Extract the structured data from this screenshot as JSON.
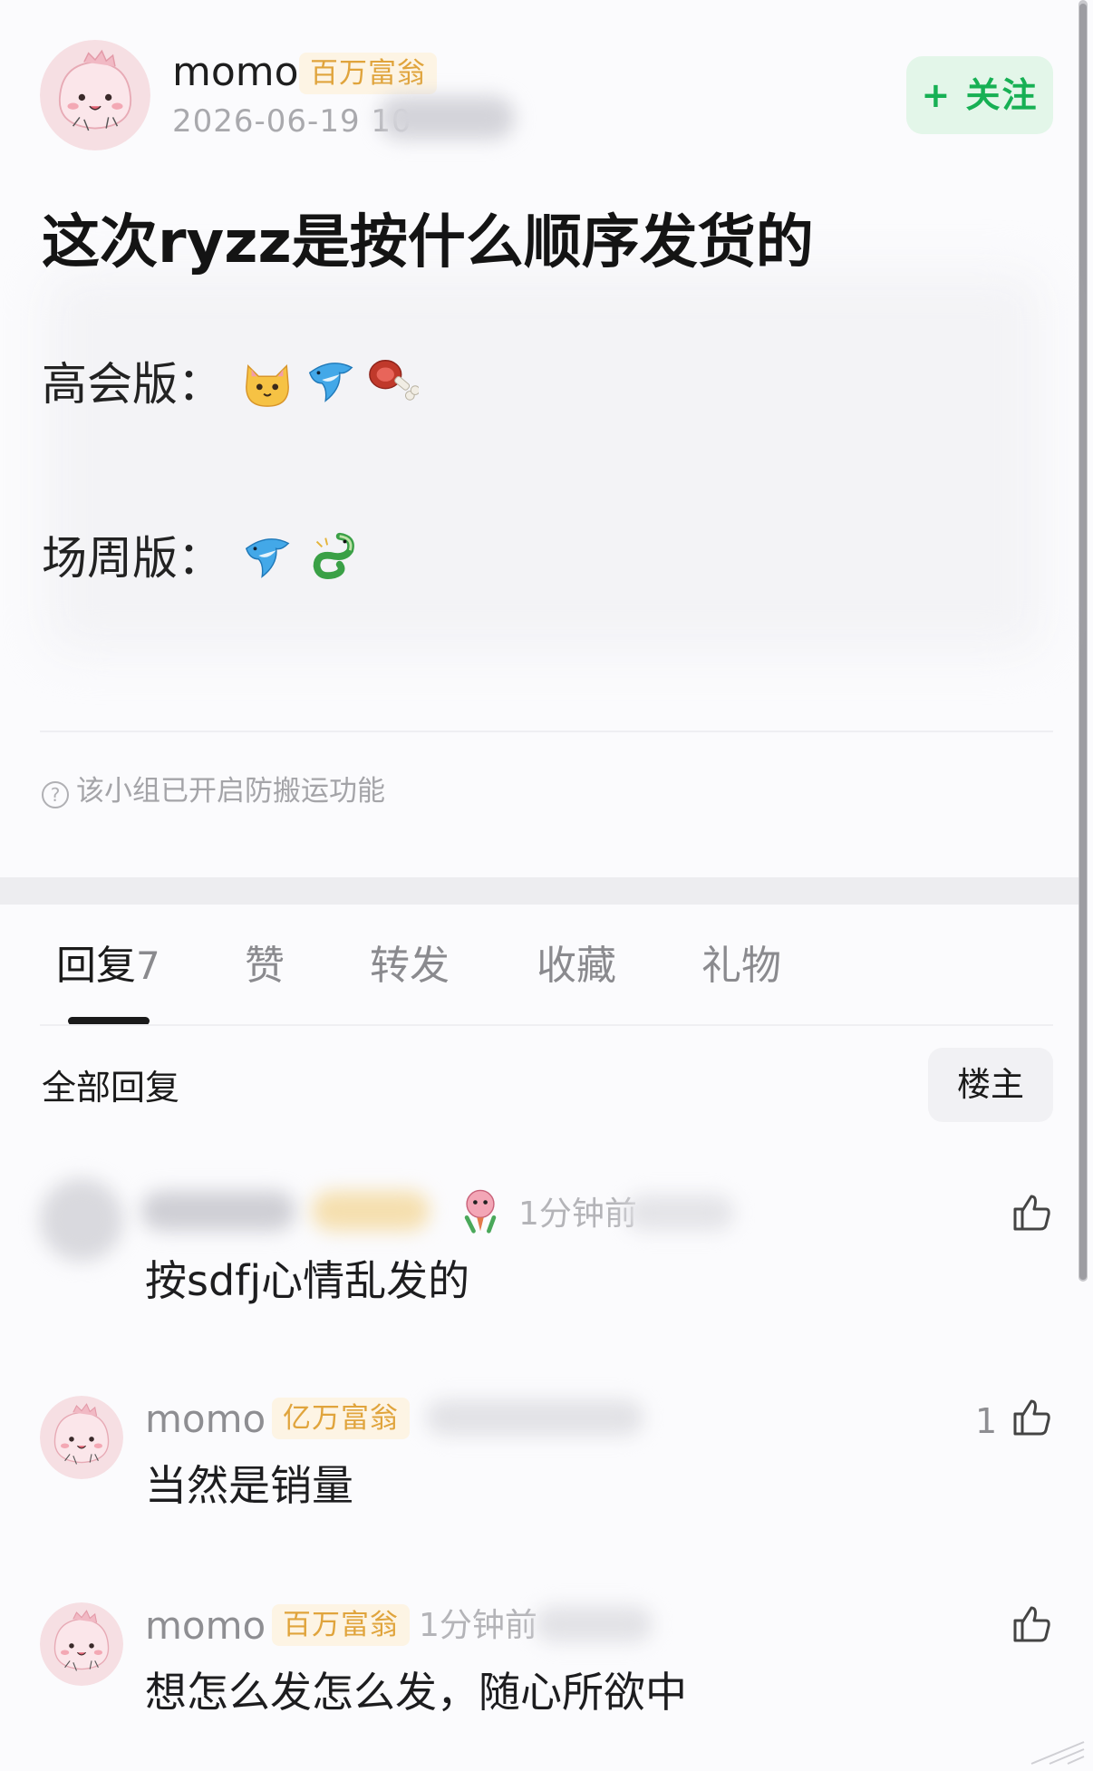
{
  "post": {
    "author": "momo",
    "badge": "百万富翁",
    "time": "2026-06-19 10",
    "follow_label": "+ 关注",
    "title": "这次ryzz是按什么顺序发货的",
    "lines": [
      {
        "label": "高会版：",
        "emojis": [
          "cat-face",
          "dolphin",
          "meat-on-bone"
        ]
      },
      {
        "label": "场周版：",
        "emojis": [
          "dolphin",
          "dragon"
        ]
      }
    ],
    "notice": "该小组已开启防搬运功能"
  },
  "tabs": [
    {
      "label": "回复",
      "count": "7",
      "active": true
    },
    {
      "label": "赞"
    },
    {
      "label": "转发"
    },
    {
      "label": "收藏"
    },
    {
      "label": "礼物"
    }
  ],
  "replies_header": {
    "title": "全部回复",
    "filter_label": "楼主"
  },
  "comments": [
    {
      "author": "",
      "badge": "",
      "time": "1分钟前",
      "text": "按sdfj心情乱发的",
      "likes": ""
    },
    {
      "author": "momo",
      "badge": "亿万富翁",
      "time": "",
      "text": "当然是销量",
      "likes": "1"
    },
    {
      "author": "momo",
      "badge": "百万富翁",
      "time": "1分钟前",
      "text": "想怎么发怎么发，随心所欲中",
      "likes": ""
    }
  ],
  "colors": {
    "badge_text": "#e0a43c",
    "follow_text": "#17b054",
    "follow_bg": "#e3f6e9",
    "avatar_bg": "#f6dfe3"
  }
}
